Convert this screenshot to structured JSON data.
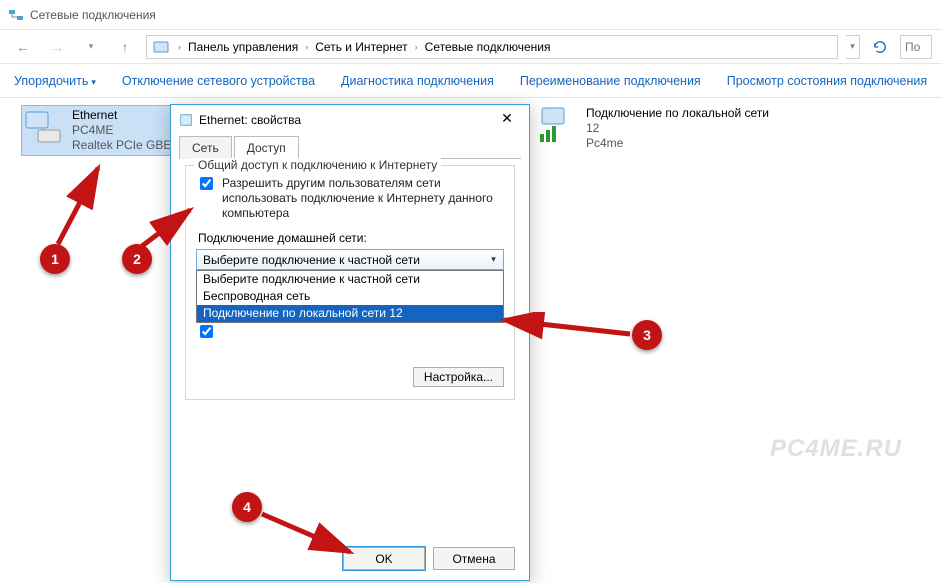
{
  "window": {
    "title": "Сетевые подключения",
    "breadcrumbs": [
      "Панель управления",
      "Сеть и Интернет",
      "Сетевые подключения"
    ],
    "search_placeholder": "По",
    "commands": {
      "organize": "Упорядочить",
      "disable": "Отключение сетевого устройства",
      "diagnose": "Диагностика подключения",
      "rename": "Переименование подключения",
      "status": "Просмотр состояния подключения"
    }
  },
  "connections": {
    "ethernet": {
      "name": "Ethernet",
      "line2": "PC4ME",
      "line3": "Realtek PCIe GBE"
    },
    "lan": {
      "name": "Подключение по локальной сети",
      "line2": "12",
      "line3": "Pc4me"
    }
  },
  "dialog": {
    "title": "Ethernet: свойства",
    "tabs": {
      "network": "Сеть",
      "sharing": "Доступ"
    },
    "group_legend": "Общий доступ к подключению к Интернету",
    "chk_allow": "Разрешить другим пользователям сети использовать подключение к Интернету данного компьютера",
    "home_net_label": "Подключение домашней сети:",
    "combo_selected": "Выберите подключение к частной сети",
    "combo_options": [
      "Выберите подключение к частной сети",
      "Беспроводная сеть",
      "Подключение по локальной сети 12"
    ],
    "settings_btn": "Настройка...",
    "ok": "OK",
    "cancel": "Отмена"
  },
  "annotations": {
    "b1": "1",
    "b2": "2",
    "b3": "3",
    "b4": "4"
  },
  "watermark": "PC4ME.RU"
}
